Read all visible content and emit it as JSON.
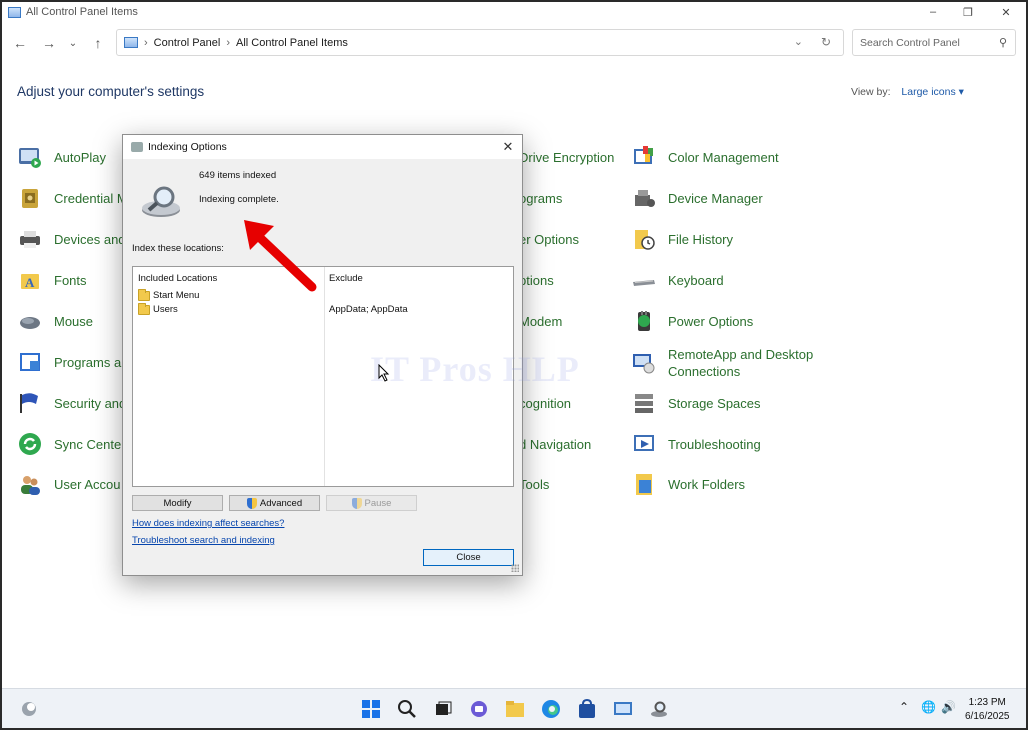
{
  "window": {
    "title": "All Control Panel Items"
  },
  "address": {
    "root": "Control Panel",
    "current": "All Control Panel Items",
    "search_placeholder": "Search Control Panel"
  },
  "header": {
    "heading": "Adjust your computer's settings",
    "view_by_label": "View by:",
    "view_by_value": "Large icons"
  },
  "items": {
    "autoplay": "AutoPlay",
    "credential": "Credential M",
    "devices": "Devices and",
    "fonts": "Fonts",
    "mouse": "Mouse",
    "programs": "Programs ar",
    "security": "Security and",
    "sync": "Sync Center",
    "user": "User Accou",
    "drive": "Drive Encryption",
    "ograms": "ograms",
    "er_options": "er Options",
    "ptions": "ptions",
    "modem": "Modem",
    "cognition": "cognition",
    "d_navigation": "d Navigation",
    "tools": "Tools",
    "color": "Color Management",
    "device_manager": "Device Manager",
    "file_history": "File History",
    "keyboard": "Keyboard",
    "power": "Power Options",
    "remoteapp_1": "RemoteApp and Desktop",
    "remoteapp_2": "Connections",
    "storage": "Storage Spaces",
    "troubleshooting": "Troubleshooting",
    "work_folders": "Work Folders"
  },
  "dialog": {
    "title": "Indexing Options",
    "count": "649 items indexed",
    "status": "Indexing complete.",
    "index_label": "Index these locations:",
    "col_included": "Included Locations",
    "col_exclude": "Exclude",
    "locations": [
      {
        "name": "Start Menu",
        "exclude": ""
      },
      {
        "name": "Users",
        "exclude": "AppData; AppData"
      }
    ],
    "btn_modify": "Modify",
    "btn_advanced": "Advanced",
    "btn_pause": "Pause",
    "link_how": "How does indexing affect searches?",
    "link_troubleshoot": "Troubleshoot search and indexing",
    "btn_close": "Close"
  },
  "watermark": "IT Pros HLP",
  "taskbar": {
    "time": "1:23 PM",
    "date": "6/16/2025"
  }
}
